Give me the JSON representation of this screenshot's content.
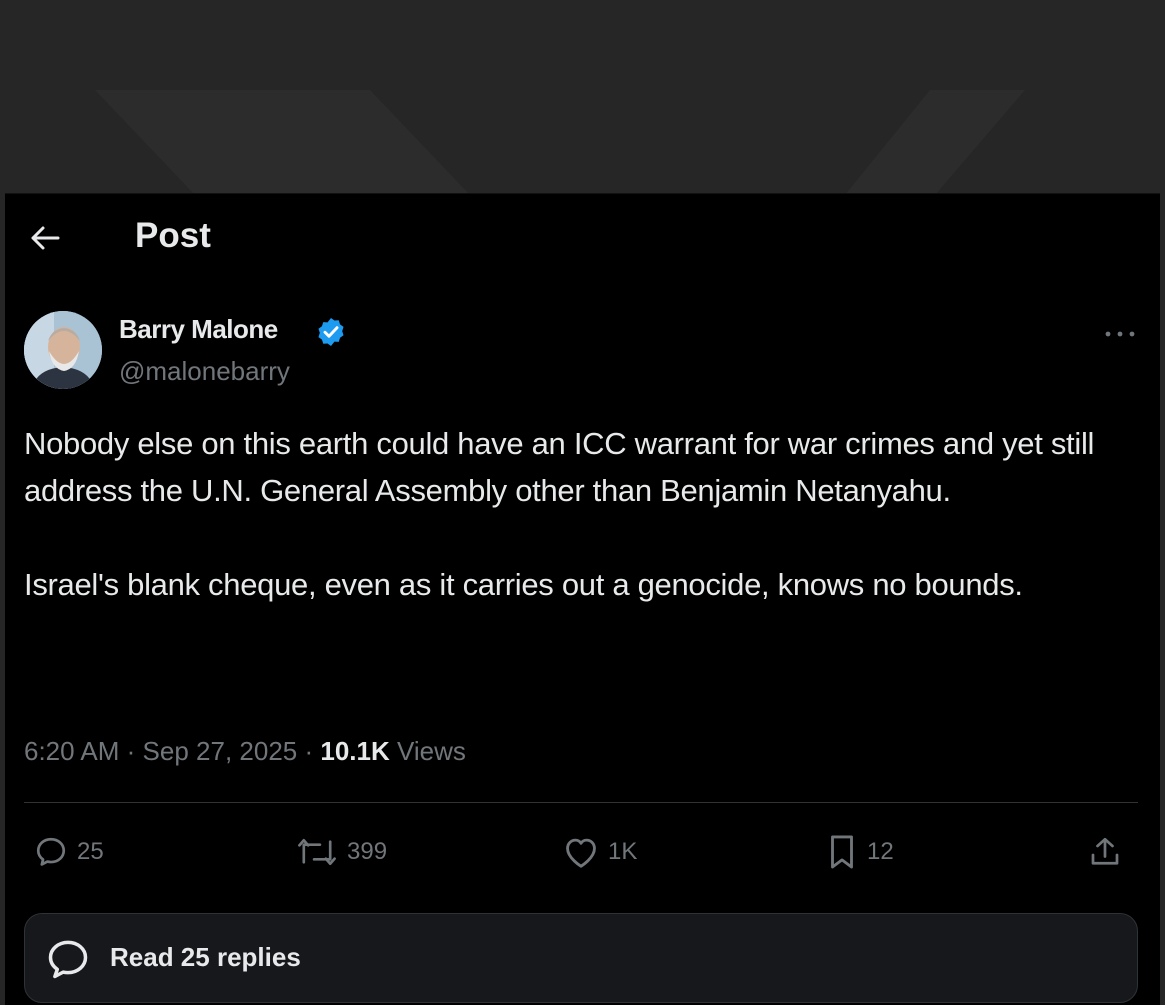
{
  "header": {
    "title": "Post",
    "back_icon": "arrow-left-icon"
  },
  "author": {
    "display_name": "Barry Malone",
    "handle": "@malonebarry",
    "verified_icon": "verified-badge-icon",
    "verified_color": "#1d9bf0"
  },
  "post": {
    "paragraphs": [
      "Nobody else on this earth could have an ICC warrant for war crimes and yet still address the U.N. General Assembly other than Benjamin Netanyahu.",
      "Israel's blank cheque, even as it carries out a genocide, knows no bounds."
    ],
    "time": "6:20 AM",
    "date": "Sep 27, 2025",
    "separator": "·",
    "views_count": "10.1K",
    "views_label": "Views"
  },
  "actions": {
    "reply": {
      "icon": "reply-icon",
      "count": "25"
    },
    "repost": {
      "icon": "repost-icon",
      "count": "399"
    },
    "like": {
      "icon": "heart-icon",
      "count": "1K"
    },
    "bookmark": {
      "icon": "bookmark-icon",
      "count": "12"
    },
    "share": {
      "icon": "share-icon"
    }
  },
  "replies_bar": {
    "icon": "chat-bubble-icon",
    "label": "Read 25 replies"
  },
  "colors": {
    "background": "#000000",
    "text": "#e7e9ea",
    "muted": "#71767b",
    "accent": "#1d9bf0"
  }
}
